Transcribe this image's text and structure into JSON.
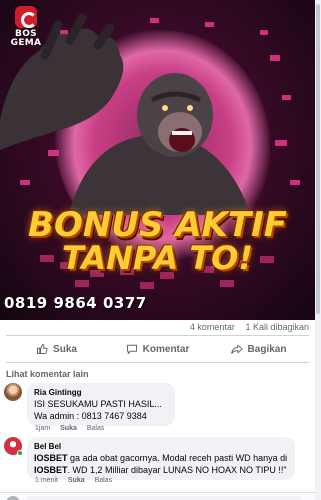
{
  "brand": {
    "name": "BOS\nGEMA"
  },
  "banner": {
    "headline_line1": "BONUS AKTIF",
    "headline_line2": "TANPA TO!",
    "phone": "0819 9864 0377"
  },
  "stats": {
    "comments": "4 komentar",
    "shares": "1 Kali dibagikan"
  },
  "actions": {
    "like": "Suka",
    "comment": "Komentar",
    "share": "Bagikan"
  },
  "more_comments": "Lihat komentar lain",
  "comments": [
    {
      "author": "Ria Gintingg",
      "line1": "ISI SESUKAMU PASTI HASIL...",
      "line2": "Wa admin : 0813 7467 9384",
      "time": "1jam",
      "like": "Suka",
      "reply": "Balas"
    },
    {
      "author": "Bel Bel",
      "brand_word_1": "IOSBET",
      "text_1": " ga ada obat gacornya. Modal receh pasti WD hanya di",
      "brand_word_2": "IOSBET",
      "text_2": ". WD 1,2 Milliar dibayar LUNAS NO HOAX NO TIPU !!\"",
      "time": "1 menit",
      "like": "Suka",
      "reply": "Balas"
    }
  ],
  "colors": {
    "accent_banner": "#d8307a",
    "headline": "#ffcc33",
    "muted_text": "#65676b",
    "bubble_bg": "#f0f2f5",
    "online": "#31a24c"
  }
}
